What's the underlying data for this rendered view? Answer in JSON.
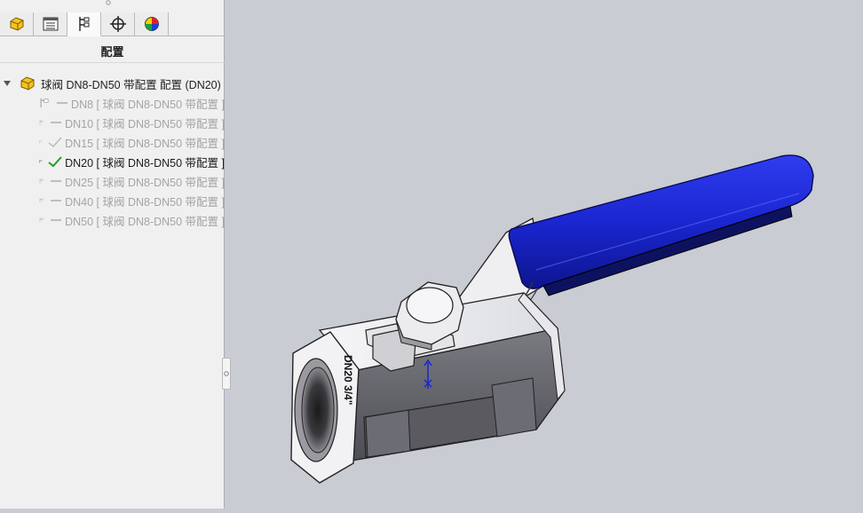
{
  "tabs": [
    {
      "name": "feature-manager-tab",
      "icon": "feature-manager-icon"
    },
    {
      "name": "property-manager-tab",
      "icon": "property-manager-icon"
    },
    {
      "name": "configuration-manager-tab",
      "icon": "configuration-manager-icon",
      "active": true
    },
    {
      "name": "dimxpert-tab",
      "icon": "crosshair-icon"
    },
    {
      "name": "display-manager-tab",
      "icon": "display-manager-icon"
    }
  ],
  "panel": {
    "title": "配置"
  },
  "tree": {
    "root_label": "球阀 DN8-DN50 带配置 配置  (DN20)",
    "configs": [
      {
        "label": "DN8 [ 球阀 DN8-DN50 带配置 ]",
        "status": "dash",
        "active": false
      },
      {
        "label": "DN10 [ 球阀 DN8-DN50 带配置 ]",
        "status": "dash",
        "active": false
      },
      {
        "label": "DN15 [ 球阀 DN8-DN50 带配置 ]",
        "status": "check",
        "active": false
      },
      {
        "label": "DN20 [ 球阀 DN8-DN50 带配置 ]",
        "status": "check",
        "active": true
      },
      {
        "label": "DN25 [ 球阀 DN8-DN50 带配置 ]",
        "status": "dash",
        "active": false
      },
      {
        "label": "DN40 [ 球阀 DN8-DN50 带配置 ]",
        "status": "dash",
        "active": false
      },
      {
        "label": "DN50 [ 球阀 DN8-DN50 带配置 ]",
        "status": "dash",
        "active": false
      }
    ]
  },
  "model": {
    "engraving": "DN20  3/4\""
  },
  "colors": {
    "handle": "#1f2bd6",
    "body": "#e8e8ec",
    "viewport_bg": "#c9ccd3"
  }
}
